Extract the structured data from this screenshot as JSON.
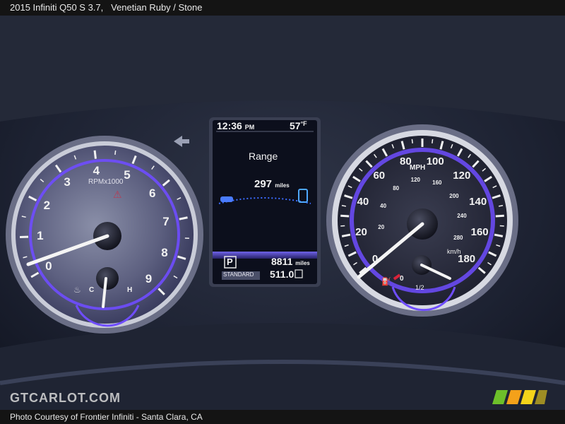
{
  "caption": {
    "title": "2015 Infiniti Q50 S 3.7,",
    "subtitle": "Venetian Ruby / Stone"
  },
  "footer": {
    "credit": "Photo Courtesy of Frontier Infiniti - Santa Clara, CA",
    "watermark": "GTCARLOT.COM"
  },
  "tachometer": {
    "numbers": [
      "0",
      "1",
      "2",
      "3",
      "4",
      "5",
      "6",
      "7",
      "8",
      "9"
    ],
    "unit_label": "RPMx1000",
    "needle_value": 1.1,
    "temp_labels": {
      "cold": "C",
      "hot": "H"
    }
  },
  "speedometer": {
    "mph_numbers": [
      "0",
      "20",
      "40",
      "60",
      "80",
      "100",
      "120",
      "140",
      "160",
      "180"
    ],
    "kmh_numbers": [
      "20",
      "40",
      "80",
      "120",
      "160",
      "200",
      "240",
      "280"
    ],
    "unit_mph": "MPH",
    "unit_kmh": "km/h",
    "needle_value_mph": 0
  },
  "fuel": {
    "labels": {
      "empty": "0",
      "half": "1/2"
    }
  },
  "display": {
    "time": "12:36",
    "ampm": "PM",
    "temperature": "57",
    "temp_unit": "°F",
    "range_label": "Range",
    "range_value": "297",
    "range_unit": "miles",
    "gear": "P",
    "mode": "STANDARD",
    "odometer": "8811",
    "odometer_unit": "miles",
    "trip": "511.0"
  },
  "colors": {
    "accent_purple": "#6f4dff",
    "needle": "#f4f4f4",
    "redline": "#d8233a"
  }
}
